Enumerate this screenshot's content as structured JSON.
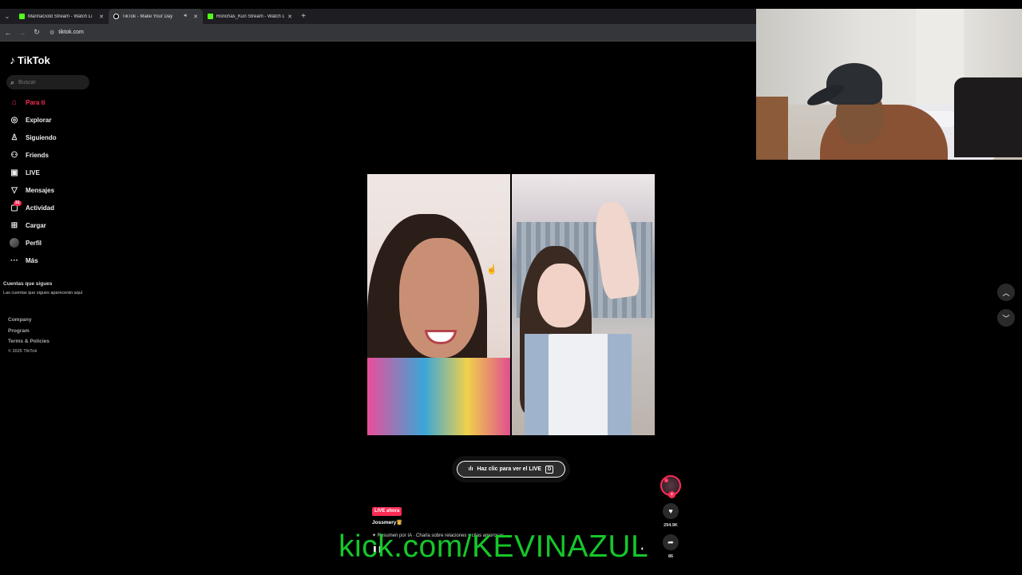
{
  "browser": {
    "tabs": [
      {
        "title": "MarinaGold Stream - Watch Li",
        "favicon": "kick-icon",
        "active": false
      },
      {
        "title": "TikTok - Make Your Day",
        "favicon": "tiktok-icon",
        "active": true
      },
      {
        "title": "Ronchas_Kun Stream - Watch L",
        "favicon": "kick-icon",
        "active": false
      }
    ],
    "url": "tiktok.com"
  },
  "sidebar": {
    "logo": "TikTok",
    "search_placeholder": "Buscar",
    "items": [
      {
        "label": "Para ti",
        "icon": "home-icon",
        "active": true
      },
      {
        "label": "Explorar",
        "icon": "compass-icon"
      },
      {
        "label": "Siguiendo",
        "icon": "following-icon"
      },
      {
        "label": "Friends",
        "icon": "friends-icon"
      },
      {
        "label": "LIVE",
        "icon": "live-tv-icon"
      },
      {
        "label": "Mensajes",
        "icon": "messages-icon"
      },
      {
        "label": "Actividad",
        "icon": "activity-icon",
        "badge": "31"
      },
      {
        "label": "Cargar",
        "icon": "upload-icon"
      },
      {
        "label": "Perfil",
        "icon": "avatar-icon"
      },
      {
        "label": "Más",
        "icon": "more-icon"
      }
    ],
    "following_title": "Cuentas que sigues",
    "following_desc": "Las cuentas que sigues aparecerán aquí",
    "footer": [
      "Company",
      "Program",
      "Terms & Policies"
    ],
    "copyright": "© 2025 TikTok"
  },
  "player": {
    "cta_label": "Haz clic para ver el LIVE",
    "cta_key": "D",
    "live_badge": "LIVE ahora",
    "username": "Jossmery👸",
    "ai_summary": "Resumen por IA · Charla sobre relaciones y citas amorosas",
    "likes": "294.9K",
    "shares": "86"
  },
  "overlay": {
    "watermark": "kick.com/KEVINAZUL"
  },
  "colors": {
    "accent": "#fe2c55",
    "watermark": "#15c62a",
    "background": "#000000"
  }
}
